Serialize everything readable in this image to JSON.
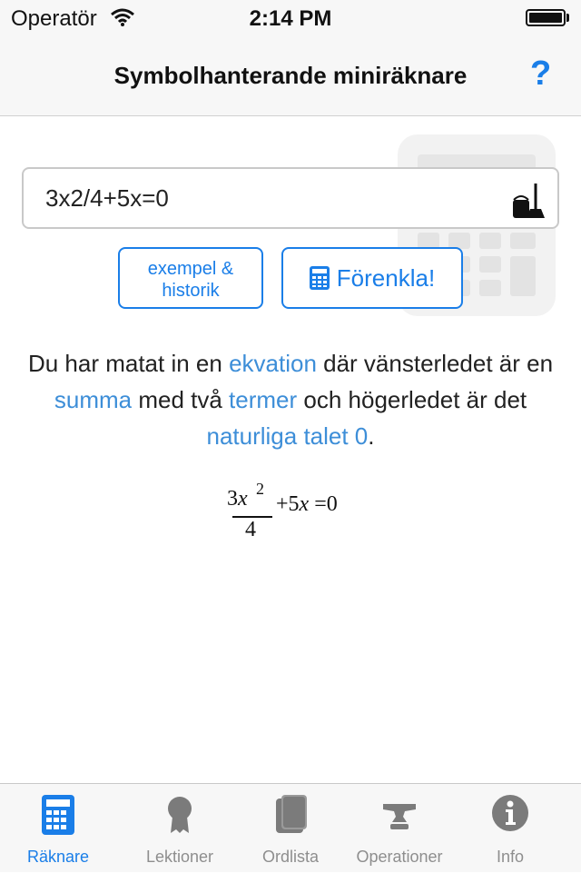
{
  "status_bar": {
    "carrier": "Operatör",
    "time": "2:14 PM",
    "icons": [
      "wifi-icon",
      "battery-icon"
    ]
  },
  "nav": {
    "title": "Symbolhanterande miniräknare",
    "help_label": "?"
  },
  "input": {
    "value": "3x2/4+5x=0",
    "clear_icon": "bucket-broom-icon"
  },
  "buttons": {
    "examples_line1": "exempel &",
    "examples_line2": "historik",
    "simplify_label": "Förenkla!",
    "simplify_icon": "calculator-icon"
  },
  "description": {
    "p1": "Du har matat in en ",
    "link_equation": "ekvation",
    "p2": " där vänsterledet är en ",
    "link_sum": "summa",
    "p3": " med två ",
    "link_terms": "termer",
    "p4": " och högerledet är det ",
    "link_number": "naturliga talet 0",
    "p5": "."
  },
  "math": {
    "numerator_coef": "3",
    "numerator_var": "x",
    "exponent": "2",
    "denominator": "4",
    "plus": "+",
    "term2_coef": "5",
    "term2_var": "x",
    "equals": "=",
    "rhs": "0"
  },
  "tabs": [
    {
      "label": "Räknare",
      "icon": "calculator-icon",
      "active": true
    },
    {
      "label": "Lektioner",
      "icon": "award-ribbon-icon",
      "active": false
    },
    {
      "label": "Ordlista",
      "icon": "book-icon",
      "active": false
    },
    {
      "label": "Operationer",
      "icon": "anvil-icon",
      "active": false
    },
    {
      "label": "Info",
      "icon": "info-icon",
      "active": false
    }
  ],
  "colors": {
    "accent": "#1a7ee8",
    "link": "#3d8ed8",
    "inactive_tab": "#8e8e8e",
    "bar_bg": "#f7f7f7"
  }
}
